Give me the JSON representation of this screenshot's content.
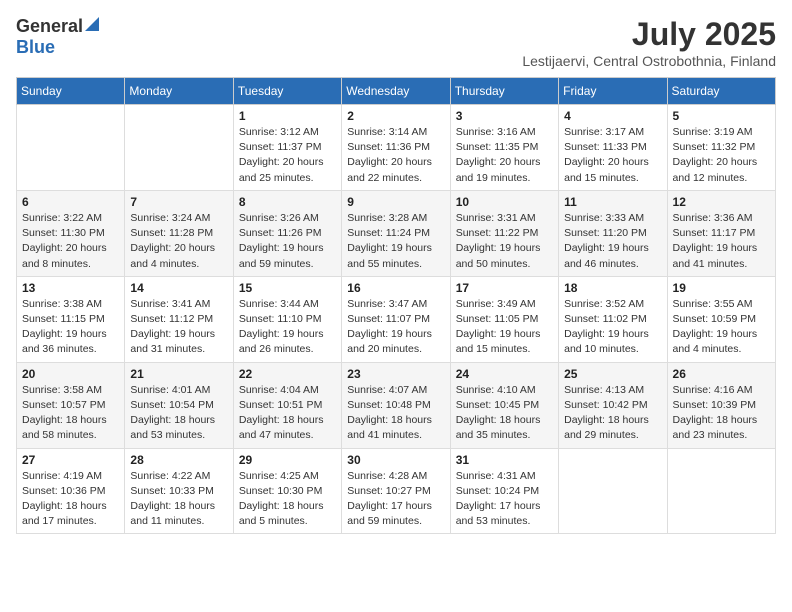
{
  "logo": {
    "general": "General",
    "blue": "Blue"
  },
  "title": "July 2025",
  "subtitle": "Lestijaervi, Central Ostrobothnia, Finland",
  "weekdays": [
    "Sunday",
    "Monday",
    "Tuesday",
    "Wednesday",
    "Thursday",
    "Friday",
    "Saturday"
  ],
  "weeks": [
    [
      {
        "day": "",
        "info": ""
      },
      {
        "day": "",
        "info": ""
      },
      {
        "day": "1",
        "info": "Sunrise: 3:12 AM\nSunset: 11:37 PM\nDaylight: 20 hours and 25 minutes."
      },
      {
        "day": "2",
        "info": "Sunrise: 3:14 AM\nSunset: 11:36 PM\nDaylight: 20 hours and 22 minutes."
      },
      {
        "day": "3",
        "info": "Sunrise: 3:16 AM\nSunset: 11:35 PM\nDaylight: 20 hours and 19 minutes."
      },
      {
        "day": "4",
        "info": "Sunrise: 3:17 AM\nSunset: 11:33 PM\nDaylight: 20 hours and 15 minutes."
      },
      {
        "day": "5",
        "info": "Sunrise: 3:19 AM\nSunset: 11:32 PM\nDaylight: 20 hours and 12 minutes."
      }
    ],
    [
      {
        "day": "6",
        "info": "Sunrise: 3:22 AM\nSunset: 11:30 PM\nDaylight: 20 hours and 8 minutes."
      },
      {
        "day": "7",
        "info": "Sunrise: 3:24 AM\nSunset: 11:28 PM\nDaylight: 20 hours and 4 minutes."
      },
      {
        "day": "8",
        "info": "Sunrise: 3:26 AM\nSunset: 11:26 PM\nDaylight: 19 hours and 59 minutes."
      },
      {
        "day": "9",
        "info": "Sunrise: 3:28 AM\nSunset: 11:24 PM\nDaylight: 19 hours and 55 minutes."
      },
      {
        "day": "10",
        "info": "Sunrise: 3:31 AM\nSunset: 11:22 PM\nDaylight: 19 hours and 50 minutes."
      },
      {
        "day": "11",
        "info": "Sunrise: 3:33 AM\nSunset: 11:20 PM\nDaylight: 19 hours and 46 minutes."
      },
      {
        "day": "12",
        "info": "Sunrise: 3:36 AM\nSunset: 11:17 PM\nDaylight: 19 hours and 41 minutes."
      }
    ],
    [
      {
        "day": "13",
        "info": "Sunrise: 3:38 AM\nSunset: 11:15 PM\nDaylight: 19 hours and 36 minutes."
      },
      {
        "day": "14",
        "info": "Sunrise: 3:41 AM\nSunset: 11:12 PM\nDaylight: 19 hours and 31 minutes."
      },
      {
        "day": "15",
        "info": "Sunrise: 3:44 AM\nSunset: 11:10 PM\nDaylight: 19 hours and 26 minutes."
      },
      {
        "day": "16",
        "info": "Sunrise: 3:47 AM\nSunset: 11:07 PM\nDaylight: 19 hours and 20 minutes."
      },
      {
        "day": "17",
        "info": "Sunrise: 3:49 AM\nSunset: 11:05 PM\nDaylight: 19 hours and 15 minutes."
      },
      {
        "day": "18",
        "info": "Sunrise: 3:52 AM\nSunset: 11:02 PM\nDaylight: 19 hours and 10 minutes."
      },
      {
        "day": "19",
        "info": "Sunrise: 3:55 AM\nSunset: 10:59 PM\nDaylight: 19 hours and 4 minutes."
      }
    ],
    [
      {
        "day": "20",
        "info": "Sunrise: 3:58 AM\nSunset: 10:57 PM\nDaylight: 18 hours and 58 minutes."
      },
      {
        "day": "21",
        "info": "Sunrise: 4:01 AM\nSunset: 10:54 PM\nDaylight: 18 hours and 53 minutes."
      },
      {
        "day": "22",
        "info": "Sunrise: 4:04 AM\nSunset: 10:51 PM\nDaylight: 18 hours and 47 minutes."
      },
      {
        "day": "23",
        "info": "Sunrise: 4:07 AM\nSunset: 10:48 PM\nDaylight: 18 hours and 41 minutes."
      },
      {
        "day": "24",
        "info": "Sunrise: 4:10 AM\nSunset: 10:45 PM\nDaylight: 18 hours and 35 minutes."
      },
      {
        "day": "25",
        "info": "Sunrise: 4:13 AM\nSunset: 10:42 PM\nDaylight: 18 hours and 29 minutes."
      },
      {
        "day": "26",
        "info": "Sunrise: 4:16 AM\nSunset: 10:39 PM\nDaylight: 18 hours and 23 minutes."
      }
    ],
    [
      {
        "day": "27",
        "info": "Sunrise: 4:19 AM\nSunset: 10:36 PM\nDaylight: 18 hours and 17 minutes."
      },
      {
        "day": "28",
        "info": "Sunrise: 4:22 AM\nSunset: 10:33 PM\nDaylight: 18 hours and 11 minutes."
      },
      {
        "day": "29",
        "info": "Sunrise: 4:25 AM\nSunset: 10:30 PM\nDaylight: 18 hours and 5 minutes."
      },
      {
        "day": "30",
        "info": "Sunrise: 4:28 AM\nSunset: 10:27 PM\nDaylight: 17 hours and 59 minutes."
      },
      {
        "day": "31",
        "info": "Sunrise: 4:31 AM\nSunset: 10:24 PM\nDaylight: 17 hours and 53 minutes."
      },
      {
        "day": "",
        "info": ""
      },
      {
        "day": "",
        "info": ""
      }
    ]
  ]
}
